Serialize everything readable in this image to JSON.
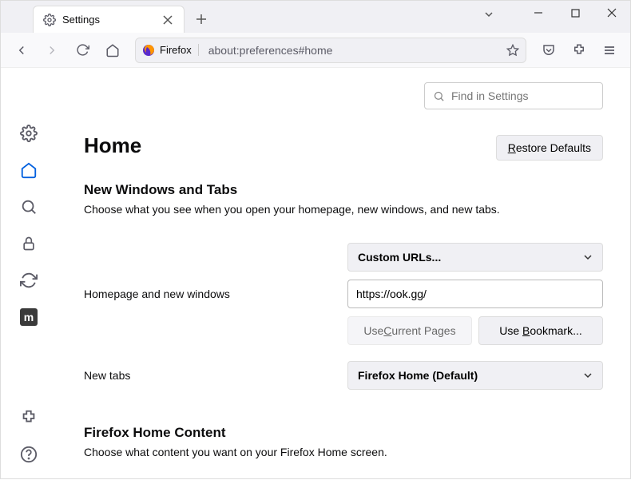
{
  "tab": {
    "title": "Settings"
  },
  "url": {
    "identity": "Firefox",
    "path": "about:preferences#home"
  },
  "search": {
    "placeholder": "Find in Settings"
  },
  "page": {
    "heading": "Home",
    "restore": "Restore Defaults",
    "restoreUnderlineChar": "R",
    "section1": {
      "title": "New Windows and Tabs",
      "desc": "Choose what you see when you open your homepage, new windows, and new tabs."
    },
    "homepage": {
      "label": "Homepage and new windows",
      "selectValue": "Custom URLs...",
      "inputValue": "https://ook.gg/",
      "useCurrent": "Use Current Pages",
      "useBookmark": "Use Bookmark..."
    },
    "newtabs": {
      "label": "New tabs",
      "selectValue": "Firefox Home (Default)"
    },
    "section2": {
      "title": "Firefox Home Content",
      "desc": "Choose what content you want on your Firefox Home screen."
    }
  },
  "sidebar": {
    "items": [
      "general",
      "home",
      "search",
      "privacy",
      "sync",
      "m",
      "extensions",
      "help"
    ]
  }
}
